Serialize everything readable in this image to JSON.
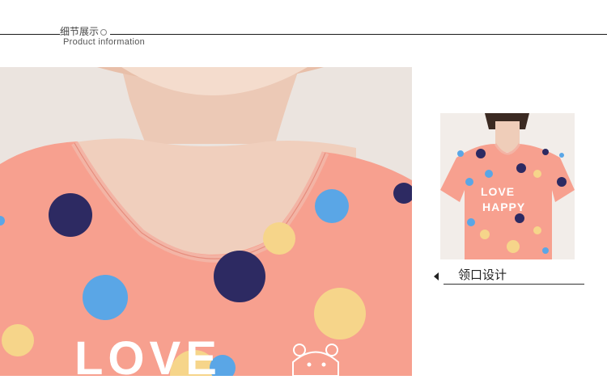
{
  "header": {
    "title_cn": "细节展示",
    "subtitle_en": "Product information"
  },
  "main_photo": {
    "print_text": "LOVE"
  },
  "thumbnail": {
    "print_line1": "LOVE",
    "print_line2": "HAPPY"
  },
  "caption": {
    "label": "领口设计"
  },
  "colors": {
    "shirt": "#f7a08f",
    "navy_dot": "#2d2a62",
    "blue_dot": "#5aa6e6",
    "yellow_dot": "#f6d58a",
    "skin": "#f0d2c0"
  }
}
